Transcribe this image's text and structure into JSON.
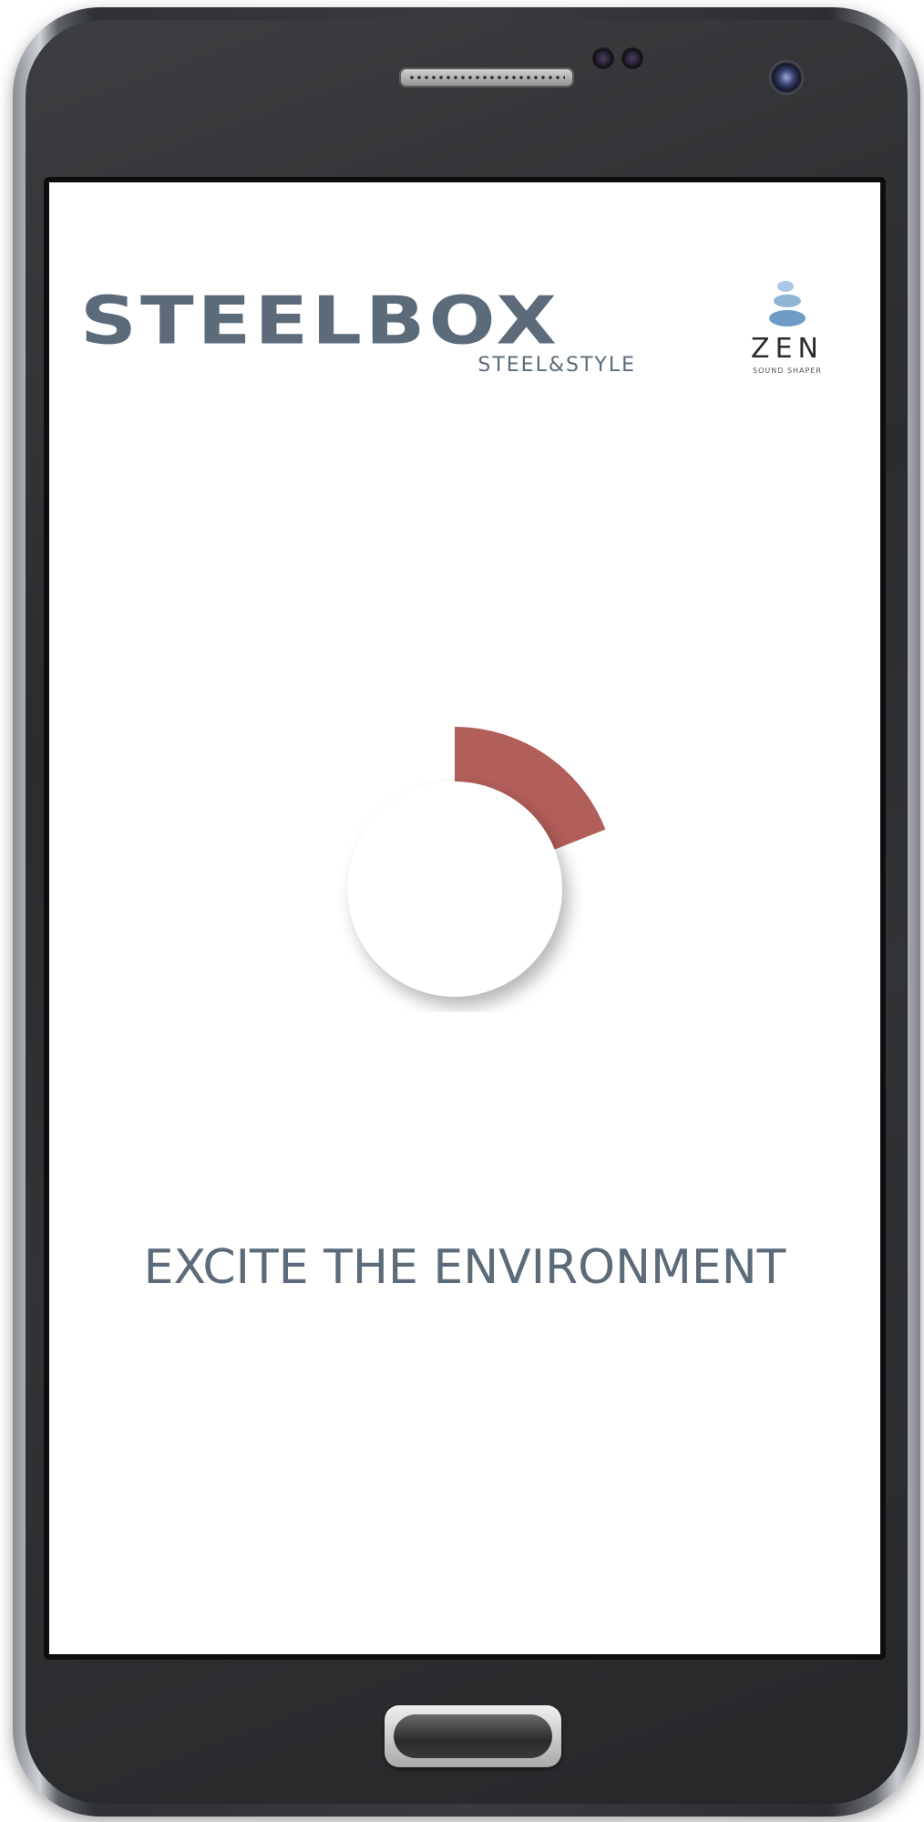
{
  "brand": {
    "name": "STEELBOX",
    "tagline": "STEEL&STYLE"
  },
  "partner": {
    "name": "ZEN",
    "tagline": "SOUND SHAPER"
  },
  "main": {
    "headline": "EXCITE THE ENVIRONMENT"
  },
  "loader": {
    "progress_fraction": 0.19
  },
  "colors": {
    "brand_gray": "#5b6b7a",
    "accent_red": "#b25e5a",
    "stone_blue": "#8fb4d6"
  },
  "icons": {
    "partner_logo": "stacked-stones-icon",
    "loader": "progress-ring-icon"
  }
}
